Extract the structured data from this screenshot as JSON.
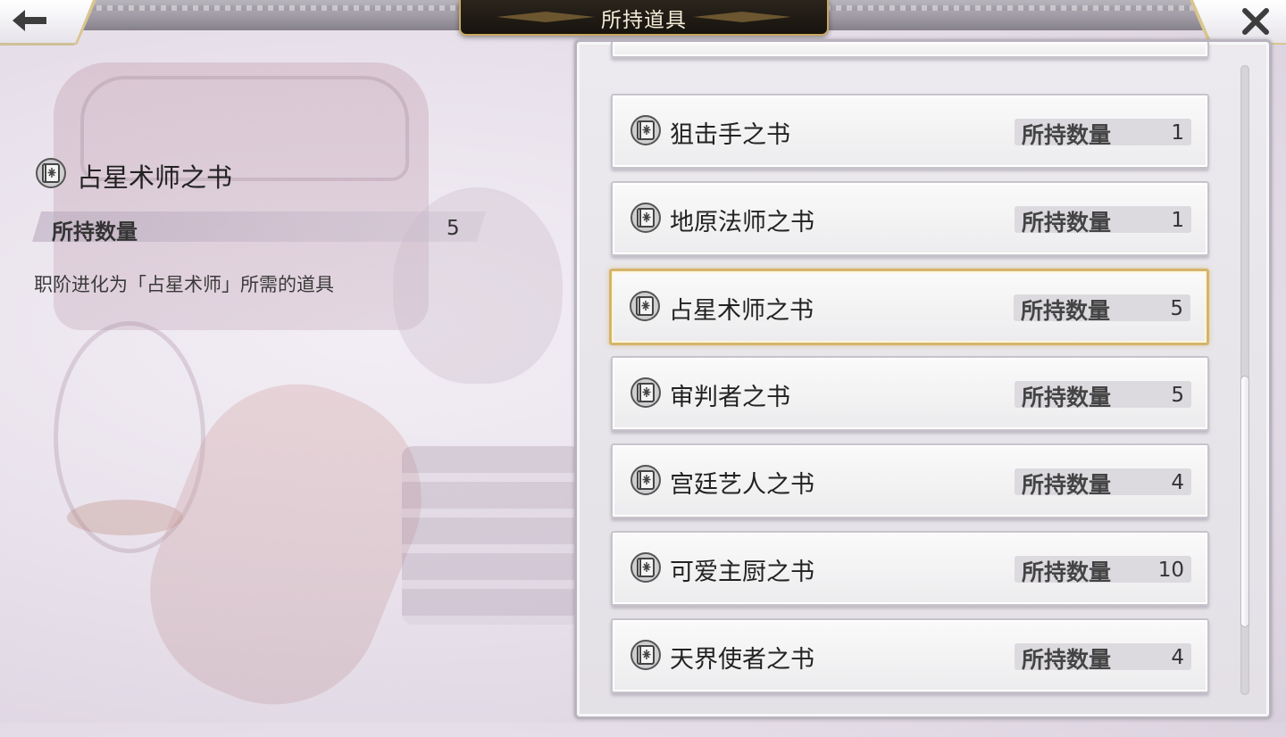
{
  "header": {
    "title": "所持道具",
    "back_icon": "back-arrow-icon",
    "close_icon": "close-icon"
  },
  "detail": {
    "icon": "book-icon",
    "name": "占星术师之书",
    "qty_label": "所持数量",
    "qty_value": "5",
    "description": "职阶进化为「占星术师」所需的道具"
  },
  "list": {
    "qty_label": "所持数量",
    "items": [
      {
        "name": "狙击手之书",
        "qty": "1",
        "selected": false
      },
      {
        "name": "地原法师之书",
        "qty": "1",
        "selected": false
      },
      {
        "name": "占星术师之书",
        "qty": "5",
        "selected": true
      },
      {
        "name": "审判者之书",
        "qty": "5",
        "selected": false
      },
      {
        "name": "宫廷艺人之书",
        "qty": "4",
        "selected": false
      },
      {
        "name": "可爱主厨之书",
        "qty": "10",
        "selected": false
      },
      {
        "name": "天界使者之书",
        "qty": "4",
        "selected": false
      }
    ],
    "scroll_position": 0.82
  },
  "colors": {
    "selected_border": "#d4b46a",
    "title_plate": "#1c1711",
    "accent_gold": "#c9a75e"
  }
}
